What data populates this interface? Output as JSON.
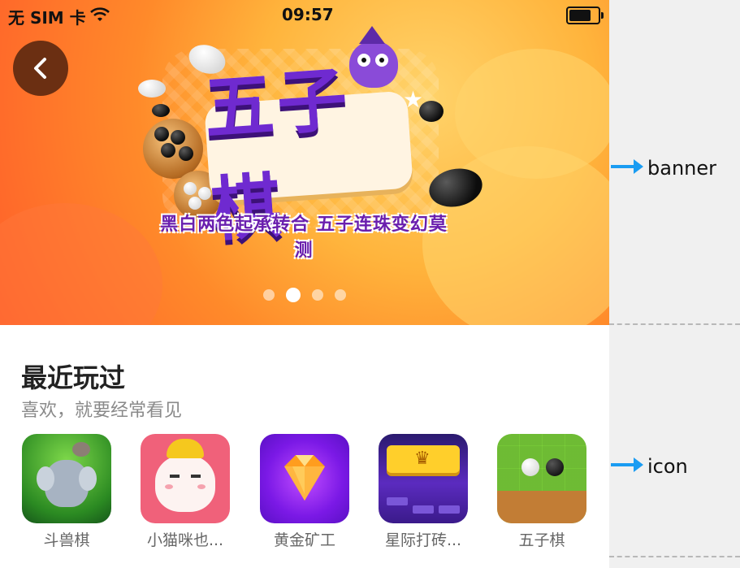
{
  "status_bar": {
    "carrier": "无 SIM 卡",
    "time": "09:57",
    "battery_level": 0.8,
    "icons": [
      "wifi-icon",
      "battery-icon"
    ]
  },
  "banner": {
    "title_text": "五子棋",
    "subtitle_text": "黑白两色起承转合  五子连珠变幻莫测",
    "carousel_dots": 4,
    "active_dot": 1,
    "icons": [
      "back-arrow-icon"
    ]
  },
  "recent": {
    "title": "最近玩过",
    "subtitle": "喜欢，就要经常看见",
    "games": [
      {
        "label": "斗兽棋"
      },
      {
        "label": "小猫咪也..."
      },
      {
        "label": "黄金矿工"
      },
      {
        "label": "星际打砖..."
      },
      {
        "label": "五子棋"
      }
    ]
  },
  "annotations": {
    "banner_label": "banner",
    "icon_label": "icon"
  },
  "colors": {
    "accent_arrow": "#1a9cf2",
    "banner_orange": "#ff8a2a",
    "back_button": "#6b2f12",
    "title_purple": "#6f2ad0"
  }
}
